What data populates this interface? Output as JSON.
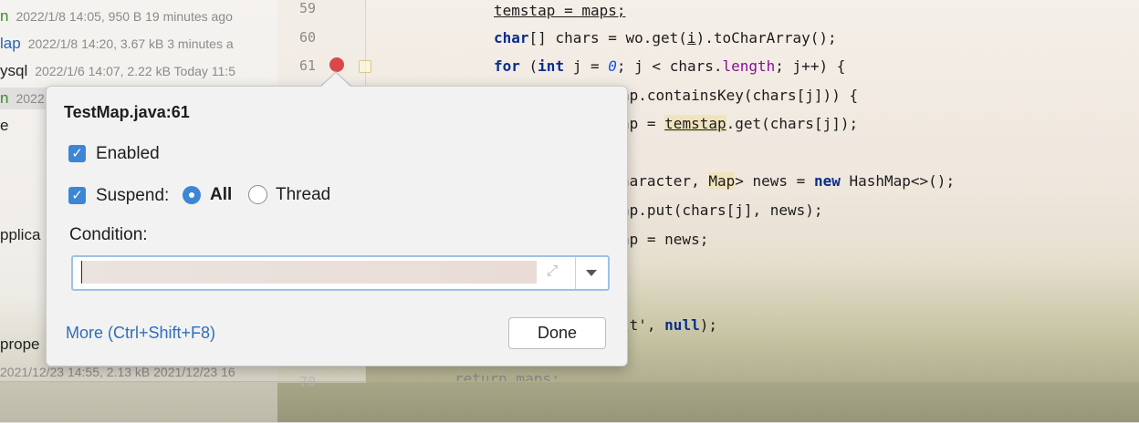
{
  "tree": {
    "rows": [
      {
        "name": "n",
        "meta": "2022/1/8 14:05, 950 B 19 minutes ago",
        "color": "green"
      },
      {
        "name": "lap",
        "meta": "2022/1/8 14:20, 3.67 kB 3 minutes a",
        "color": "blue"
      },
      {
        "name": "ysql",
        "meta": "2022/1/6 14:07, 2.22 kB Today 11:5",
        "color": "default"
      },
      {
        "name": "n",
        "meta": "2022",
        "color": "green"
      },
      {
        "name": "e",
        "meta": "",
        "color": "default"
      },
      {
        "name": "pplica",
        "meta": "",
        "color": "default"
      },
      {
        "name": "prope",
        "meta": "",
        "color": "default"
      },
      {
        "name": "",
        "meta": "2021/12/23 14:55, 2.13 kB 2021/12/23 16",
        "color": "default"
      }
    ]
  },
  "gutter": {
    "line_numbers": [
      "59",
      "60",
      "61",
      "70"
    ]
  },
  "code": {
    "line59": "temstap = maps;",
    "line60_kw": "char",
    "line60_rest": "[] chars = wo.get(",
    "line60_i": "i",
    "line60_end": ").toCharArray();",
    "line61_for": "for",
    "line61_a": " (",
    "line61_int": "int",
    "line61_b": " j = ",
    "line61_zero": "0",
    "line61_c": "; j < chars.",
    "line61_length": "length",
    "line61_d": "; j++) {",
    "line62": "ap.containsKey(chars[j])) {",
    "line63_a": "ap = ",
    "line63_temstap": "temstap",
    "line63_b": ".get(chars[j]);",
    "line65_a": "haracter, ",
    "line65_map": "Map",
    "line65_b": "> news = ",
    "line65_new": "new",
    "line65_c": " HashMap<>();",
    "line66": "ap.put(chars[j], news);",
    "line67": "ap = news;",
    "line70_a": "\\t', ",
    "line70_null": "null",
    "line70_b": ");",
    "line72": "return maps;"
  },
  "popup": {
    "title": "TestMap.java:61",
    "enabled_label": "Enabled",
    "suspend_label": "Suspend:",
    "all_label": "All",
    "thread_label": "Thread",
    "condition_label": "Condition:",
    "condition_value": "",
    "more_link": "More (Ctrl+Shift+F8)",
    "done_label": "Done",
    "enabled_checked": true,
    "suspend_checked": true,
    "suspend_mode": "All"
  },
  "colors": {
    "accent": "#3d86d6",
    "breakpoint": "#d8484a",
    "link": "#2f6fb8"
  }
}
